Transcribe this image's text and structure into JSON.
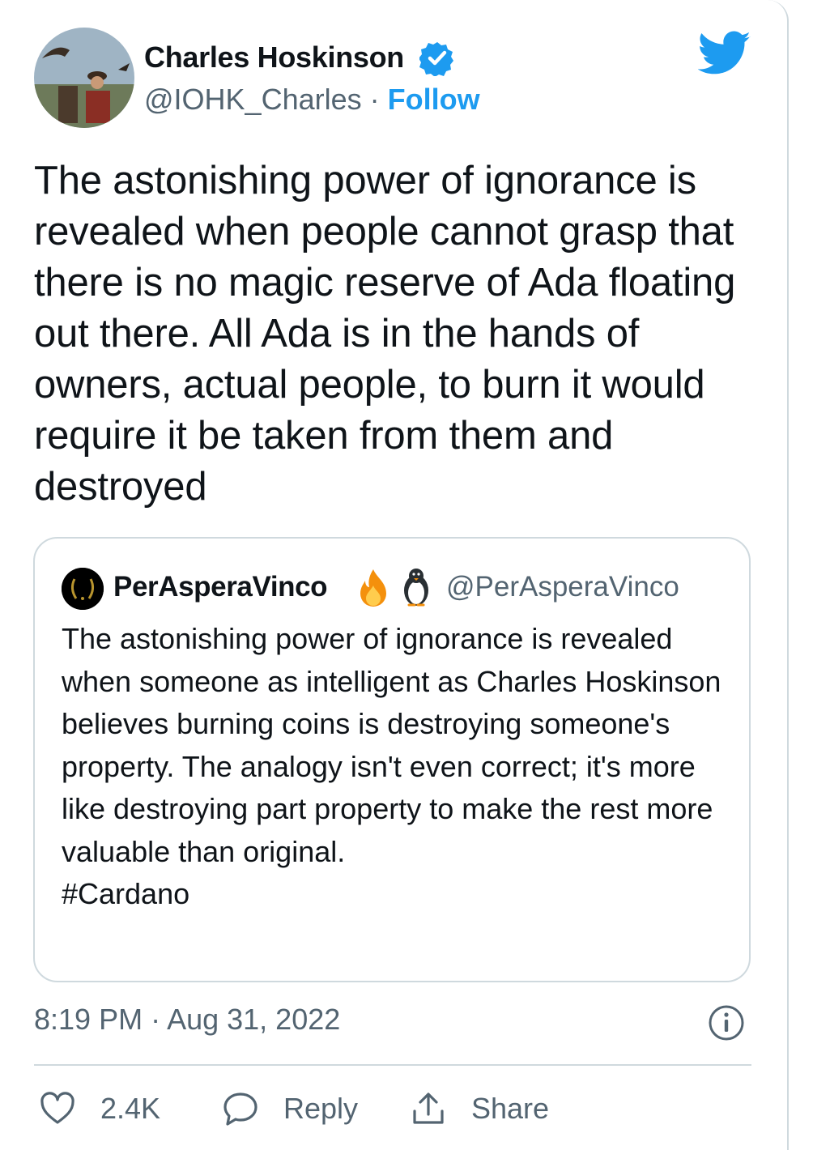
{
  "author": {
    "display_name": "Charles Hoskinson",
    "handle": "@IOHK_Charles",
    "separator": " · ",
    "follow_label": "Follow"
  },
  "tweet": {
    "text": "The astonishing power of ignorance is revealed when people cannot grasp that there is no magic reserve of Ada floating out there. All Ada is in the hands of owners, actual people, to burn it would require it be taken from them and destroyed"
  },
  "quoted_tweet": {
    "display_name": "PerAsperaVinco",
    "handle": "@PerAsperaVinco",
    "text": "The astonishing power of ignorance is revealed when someone as intelligent as Charles Hoskinson believes burning coins is destroying someone's property. The analogy isn't even correct; it's more like destroying part property to make the rest more valuable than original.",
    "hashtag": "#Cardano"
  },
  "meta": {
    "timestamp": "8:19 PM · Aug 31, 2022"
  },
  "actions": {
    "like_count": "2.4K",
    "reply_label": "Reply",
    "share_label": "Share"
  },
  "colors": {
    "accent": "#1d9bf0",
    "text": "#0f1419",
    "secondary": "#536471",
    "border": "#cfd9de"
  }
}
